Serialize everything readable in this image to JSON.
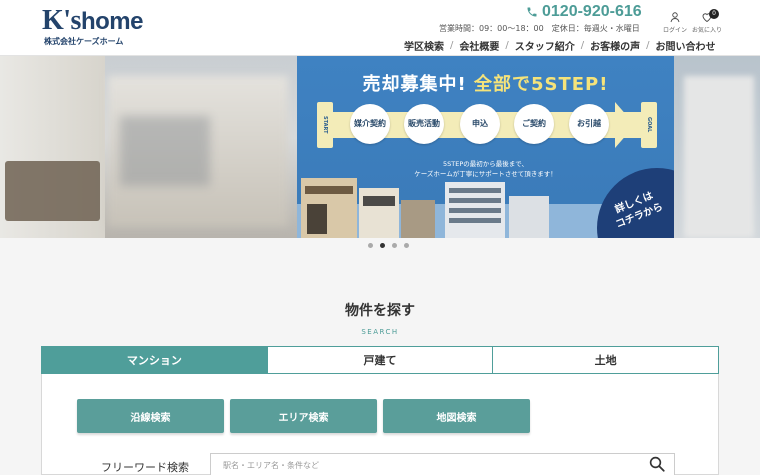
{
  "header": {
    "logo_main": "K's",
    "logo_home": "home",
    "logo_sub": "株式会社ケーズホーム",
    "phone": "0120-920-616",
    "hours": "営業時間：09：00〜18：00　定休日：毎週火・水曜日",
    "login_label": "ログイン",
    "favorites_label": "お気に入り",
    "favorites_count": "0",
    "nav": [
      "学区検索",
      "会社概要",
      "スタッフ紹介",
      "お客様の声",
      "お問い合わせ"
    ]
  },
  "banner": {
    "title_pre": "売却募集中! ",
    "title_highlight": "全部で5STEP!",
    "start_label": "START",
    "goal_label": "GOAL",
    "steps": [
      "媒介契約",
      "販売活動",
      "申込",
      "ご契約",
      "お引越"
    ],
    "desc_line1": "5STEPの最初から最後まで、",
    "desc_line2": "ケーズホームが丁寧にサポートさせて頂きます！",
    "cta_line1": "詳しくは",
    "cta_line2": "コチラから"
  },
  "carousel": {
    "count": 4,
    "active_index": 1
  },
  "search": {
    "title": "物件を探す",
    "subtitle": "SEARCH",
    "tabs": [
      "マンション",
      "戸建て",
      "土地"
    ],
    "active_tab": 0,
    "buttons": [
      "沿線検索",
      "エリア検索",
      "地図検索"
    ],
    "freeword_label": "フリーワード検索",
    "freeword_placeholder": "駅名・エリア名・条件など"
  },
  "colors": {
    "accent": "#4f9e9a",
    "logo": "#23436b",
    "banner_blue": "#3f82c2"
  }
}
